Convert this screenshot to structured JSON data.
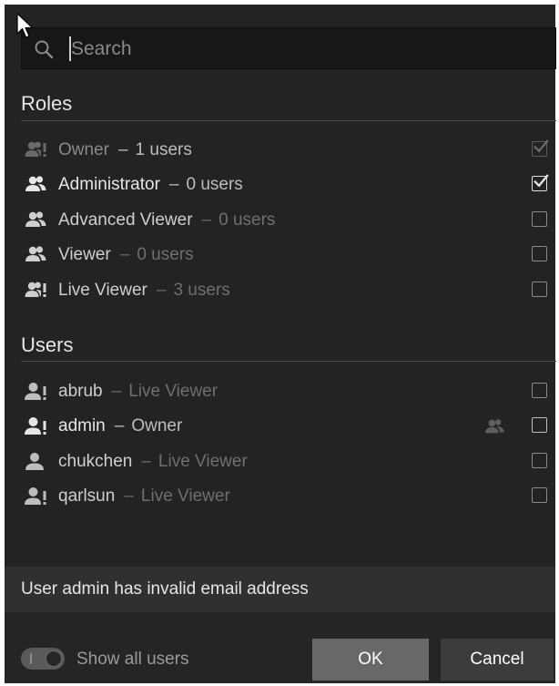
{
  "search": {
    "placeholder": "Search",
    "value": ""
  },
  "roles_section": {
    "title": "Roles",
    "items": [
      {
        "name": "Owner",
        "separator": "–",
        "count": "1 users",
        "checked": true,
        "disabled": true,
        "icon": "user-group-alert-icon"
      },
      {
        "name": "Administrator",
        "separator": "–",
        "count": "0 users",
        "checked": true,
        "disabled": false,
        "icon": "user-group-icon"
      },
      {
        "name": "Advanced Viewer",
        "separator": "–",
        "count": "0 users",
        "checked": false,
        "disabled": false,
        "icon": "user-group-icon"
      },
      {
        "name": "Viewer",
        "separator": "–",
        "count": "0 users",
        "checked": false,
        "disabled": false,
        "icon": "user-group-icon"
      },
      {
        "name": "Live Viewer",
        "separator": "–",
        "count": "3 users",
        "checked": false,
        "disabled": false,
        "icon": "user-group-alert-icon"
      }
    ]
  },
  "users_section": {
    "title": "Users",
    "items": [
      {
        "name": "abrub",
        "separator": "–",
        "role": "Live Viewer",
        "checked": false,
        "icon": "user-alert-icon"
      },
      {
        "name": "admin",
        "separator": "–",
        "role": "Owner",
        "checked": false,
        "icon": "user-alert-icon",
        "extra_icon": "user-group-icon"
      },
      {
        "name": "chukchen",
        "separator": "–",
        "role": "Live Viewer",
        "checked": false,
        "icon": "user-icon"
      },
      {
        "name": "qarlsun",
        "separator": "–",
        "role": "Live Viewer",
        "checked": false,
        "icon": "user-alert-icon"
      }
    ]
  },
  "status": {
    "message": "User admin has invalid email address"
  },
  "footer": {
    "toggle_label": "Show all users",
    "toggle_on": false,
    "ok_label": "OK",
    "cancel_label": "Cancel"
  },
  "colors": {
    "panel_bg": "#232323",
    "search_bg": "#171717",
    "status_bg": "#303030",
    "ok_bg": "#686868",
    "cancel_bg": "#3c3c3c"
  }
}
